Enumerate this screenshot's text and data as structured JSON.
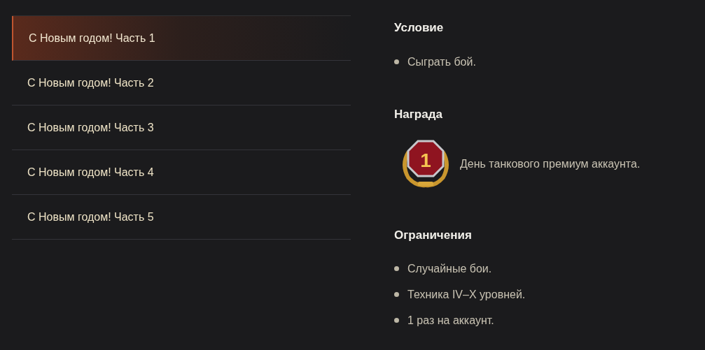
{
  "quests": [
    {
      "label": "С Новым годом! Часть 1",
      "selected": true
    },
    {
      "label": "С Новым годом! Часть 2",
      "selected": false
    },
    {
      "label": "С Новым годом! Часть 3",
      "selected": false
    },
    {
      "label": "С Новым годом! Часть 4",
      "selected": false
    },
    {
      "label": "С Новым годом! Часть 5",
      "selected": false
    }
  ],
  "condition": {
    "title": "Условие",
    "items": [
      "Сыграть бой."
    ]
  },
  "reward": {
    "title": "Награда",
    "badge": "1",
    "text": "День танкового премиум аккаунта."
  },
  "restrictions": {
    "title": "Ограничения",
    "items": [
      "Случайные бои.",
      "Техника IV–X уровней.",
      "1 раз на аккаунт."
    ]
  }
}
